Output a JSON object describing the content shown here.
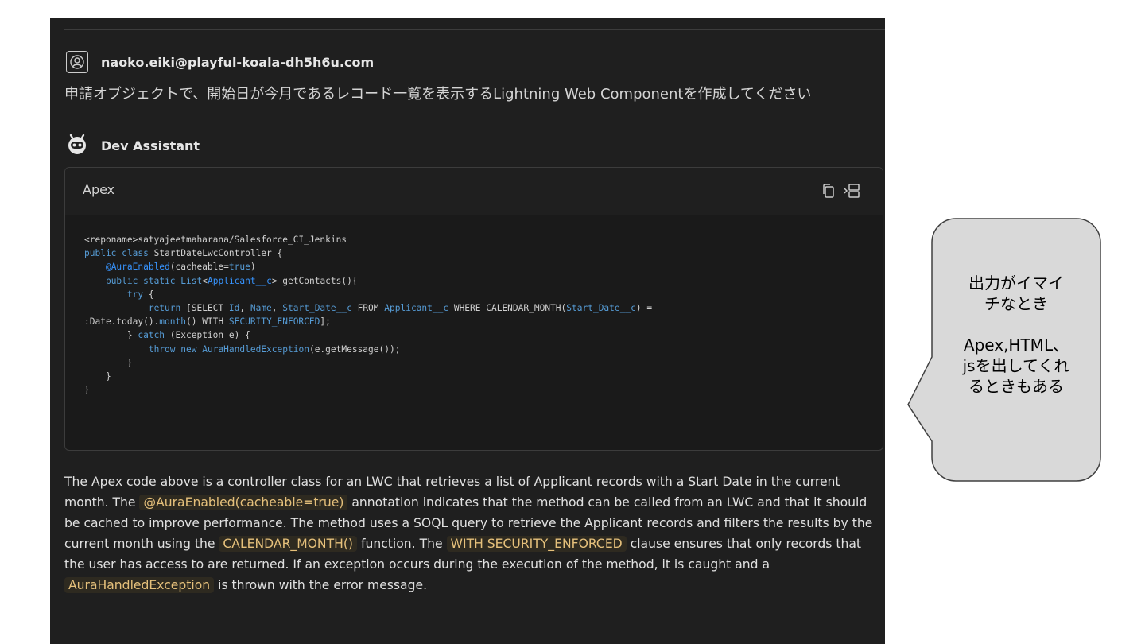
{
  "user": {
    "email": "naoko.eiki@playful-koala-dh5h6u.com",
    "prompt": "申請オブジェクトで、開始日が今月であるレコード一覧を表示するLightning Web Componentを作成してください"
  },
  "assistant": {
    "name": "Dev Assistant"
  },
  "code_block": {
    "language": "Apex",
    "line1": "<reponame>satyajeetmaharana/Salesforce_CI_Jenkins",
    "copy_icon": "copy-icon",
    "insert_icon": "insert-into-editor-icon"
  },
  "description": {
    "p1": "The Apex code above is a controller class for an LWC that retrieves a list of Applicant records with a Start Date in the current month. The ",
    "code1": "@AuraEnabled(cacheable=true)",
    "p2": " annotation indicates that the method can be called from an LWC and that it should be cached to improve performance. The method uses a SOQL query to retrieve the Applicant records and filters the results by the current month using the ",
    "code2": "CALENDAR_MONTH()",
    "p3": " function. The ",
    "code3": "WITH SECURITY_ENFORCED",
    "p4": " clause ensures that only records that the user has access to are returned. If an exception occurs during the execution of the method, it is caught and a ",
    "code4": "AuraHandledException",
    "p5": " is thrown with the error message."
  },
  "callout": {
    "line1": "出力がイマイ",
    "line2": "チなとき",
    "line3": "Apex,HTML、",
    "line4": "jsを出してくれ",
    "line5": "るときもある"
  },
  "colors": {
    "panel_bg": "#1f1f1f",
    "highlight_text": "#e5c07b",
    "keyword": "#569cd6",
    "callout_fill": "#d9d9d9"
  }
}
